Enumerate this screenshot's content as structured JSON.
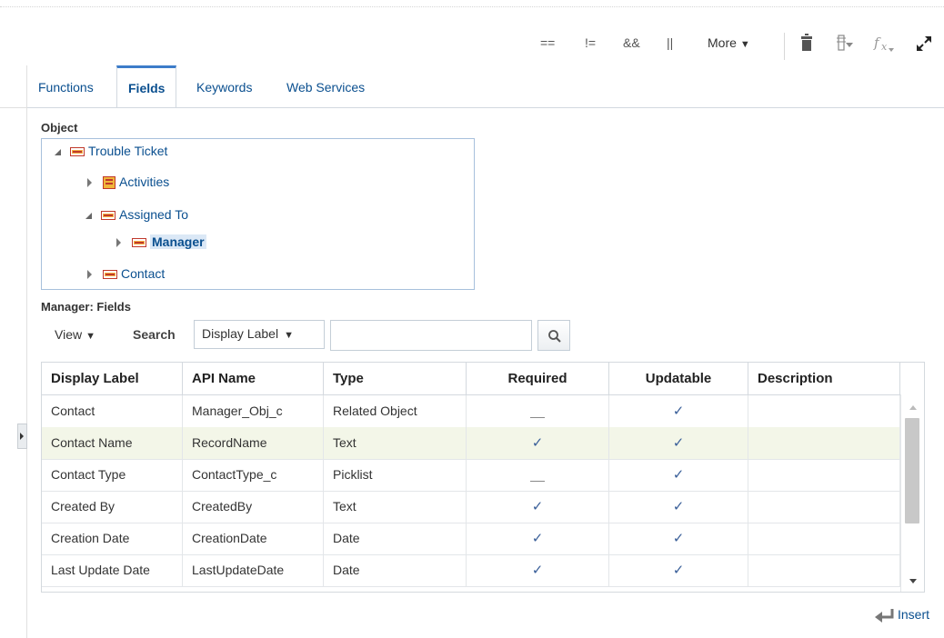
{
  "toolbar": {
    "ops": [
      "==",
      "!=",
      "&&",
      "||"
    ],
    "more_label": "More",
    "icons": [
      "delete-icon",
      "filter-icon",
      "function-icon",
      "expand-icon"
    ]
  },
  "tabs": [
    {
      "label": "Functions",
      "active": false
    },
    {
      "label": "Fields",
      "active": true
    },
    {
      "label": "Keywords",
      "active": false
    },
    {
      "label": "Web Services",
      "active": false
    }
  ],
  "object_section": {
    "label": "Object",
    "tree": [
      {
        "label": "Trouble Ticket",
        "expanded": true,
        "icon": "object-icon"
      },
      {
        "label": "Activities",
        "expanded": false,
        "icon": "collection-icon"
      },
      {
        "label": "Assigned To",
        "expanded": true,
        "icon": "object-icon"
      },
      {
        "label": "Manager",
        "expanded": false,
        "icon": "object-icon",
        "selected": true
      },
      {
        "label": "Contact",
        "expanded": false,
        "icon": "object-icon"
      }
    ]
  },
  "fields_section": {
    "label": "Manager: Fields",
    "view_label": "View",
    "search_label": "Search",
    "search_by": "Display Label",
    "search_value": ""
  },
  "grid": {
    "columns": [
      "Display Label",
      "API Name",
      "Type",
      "Required",
      "Updatable",
      "Description"
    ],
    "rows": [
      {
        "display": "Contact",
        "api": "Manager_Obj_c",
        "type": "Related Object",
        "required": false,
        "updatable": true,
        "description": "",
        "highlighted": false
      },
      {
        "display": "Contact Name",
        "api": "RecordName",
        "type": "Text",
        "required": true,
        "updatable": true,
        "description": "",
        "highlighted": true
      },
      {
        "display": "Contact Type",
        "api": "ContactType_c",
        "type": "Picklist",
        "required": false,
        "updatable": true,
        "description": "",
        "highlighted": false
      },
      {
        "display": "Created By",
        "api": "CreatedBy",
        "type": "Text",
        "required": true,
        "updatable": true,
        "description": "",
        "highlighted": false
      },
      {
        "display": "Creation Date",
        "api": "CreationDate",
        "type": "Date",
        "required": true,
        "updatable": true,
        "description": "",
        "highlighted": false
      },
      {
        "display": "Last Update Date",
        "api": "LastUpdateDate",
        "type": "Date",
        "required": true,
        "updatable": true,
        "description": "",
        "highlighted": false
      }
    ],
    "check_glyph": "✓"
  },
  "insert_label": "Insert",
  "colors": {
    "link": "#0a4f8f",
    "tab_accent": "#3d7cc9",
    "row_highlight": "#f3f6e8",
    "check": "#3a5f99"
  }
}
